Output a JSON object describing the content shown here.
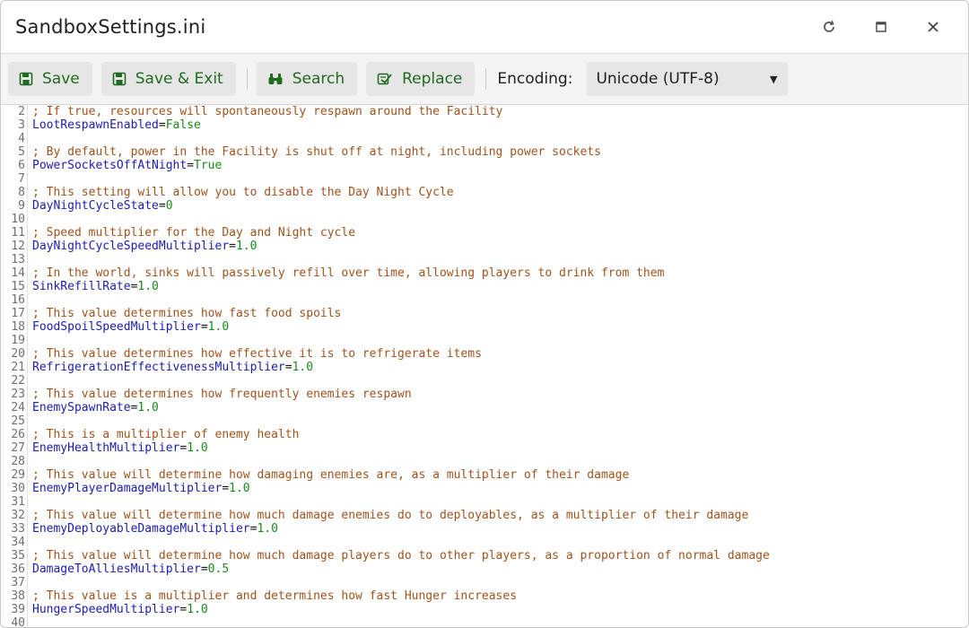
{
  "window": {
    "title": "SandboxSettings.ini",
    "controls": [
      "refresh-icon",
      "maximize-icon",
      "close-icon"
    ]
  },
  "toolbar": {
    "save_label": "Save",
    "save_exit_label": "Save & Exit",
    "search_label": "Search",
    "replace_label": "Replace",
    "encoding_label": "Encoding:",
    "encoding_value": "Unicode (UTF-8)",
    "accent_color": "#1f6b1f"
  },
  "editor": {
    "lines": [
      {
        "n": "2",
        "type": "comment",
        "text": "; If true, resources will spontaneously respawn around the Facility"
      },
      {
        "n": "3",
        "type": "kv",
        "key": "LootRespawnEnabled",
        "value": "False"
      },
      {
        "n": "4",
        "type": "blank"
      },
      {
        "n": "5",
        "type": "comment",
        "text": "; By default, power in the Facility is shut off at night, including power sockets"
      },
      {
        "n": "6",
        "type": "kv",
        "key": "PowerSocketsOffAtNight",
        "value": "True"
      },
      {
        "n": "7",
        "type": "blank"
      },
      {
        "n": "8",
        "type": "comment",
        "text": "; This setting will allow you to disable the Day Night Cycle"
      },
      {
        "n": "9",
        "type": "kv",
        "key": "DayNightCycleState",
        "value": "0"
      },
      {
        "n": "10",
        "type": "blank"
      },
      {
        "n": "11",
        "type": "comment",
        "text": "; Speed multiplier for the Day and Night cycle"
      },
      {
        "n": "12",
        "type": "kv",
        "key": "DayNightCycleSpeedMultiplier",
        "value": "1.0"
      },
      {
        "n": "13",
        "type": "blank"
      },
      {
        "n": "14",
        "type": "comment",
        "text": "; In the world, sinks will passively refill over time, allowing players to drink from them"
      },
      {
        "n": "15",
        "type": "kv",
        "key": "SinkRefillRate",
        "value": "1.0"
      },
      {
        "n": "16",
        "type": "blank"
      },
      {
        "n": "17",
        "type": "comment",
        "text": "; This value determines how fast food spoils"
      },
      {
        "n": "18",
        "type": "kv",
        "key": "FoodSpoilSpeedMultiplier",
        "value": "1.0"
      },
      {
        "n": "19",
        "type": "blank"
      },
      {
        "n": "20",
        "type": "comment",
        "text": "; This value determines how effective it is to refrigerate items"
      },
      {
        "n": "21",
        "type": "kv",
        "key": "RefrigerationEffectivenessMultiplier",
        "value": "1.0"
      },
      {
        "n": "22",
        "type": "blank"
      },
      {
        "n": "23",
        "type": "comment",
        "text": "; This value determines how frequently enemies respawn"
      },
      {
        "n": "24",
        "type": "kv",
        "key": "EnemySpawnRate",
        "value": "1.0"
      },
      {
        "n": "25",
        "type": "blank"
      },
      {
        "n": "26",
        "type": "comment",
        "text": "; This is a multiplier of enemy health"
      },
      {
        "n": "27",
        "type": "kv",
        "key": "EnemyHealthMultiplier",
        "value": "1.0"
      },
      {
        "n": "28",
        "type": "blank"
      },
      {
        "n": "29",
        "type": "comment",
        "text": "; This value will determine how damaging enemies are, as a multiplier of their damage"
      },
      {
        "n": "30",
        "type": "kv",
        "key": "EnemyPlayerDamageMultiplier",
        "value": "1.0"
      },
      {
        "n": "31",
        "type": "blank"
      },
      {
        "n": "32",
        "type": "comment",
        "text": "; This value will determine how much damage enemies do to deployables, as a multiplier of their damage"
      },
      {
        "n": "33",
        "type": "kv",
        "key": "EnemyDeployableDamageMultiplier",
        "value": "1.0"
      },
      {
        "n": "34",
        "type": "blank"
      },
      {
        "n": "35",
        "type": "comment",
        "text": "; This value will determine how much damage players do to other players, as a proportion of normal damage"
      },
      {
        "n": "36",
        "type": "kv",
        "key": "DamageToAlliesMultiplier",
        "value": "0.5"
      },
      {
        "n": "37",
        "type": "blank"
      },
      {
        "n": "38",
        "type": "comment",
        "text": "; This value is a multiplier and determines how fast Hunger increases"
      },
      {
        "n": "39",
        "type": "kv",
        "key": "HungerSpeedMultiplier",
        "value": "1.0"
      },
      {
        "n": "40",
        "type": "blank"
      }
    ]
  }
}
